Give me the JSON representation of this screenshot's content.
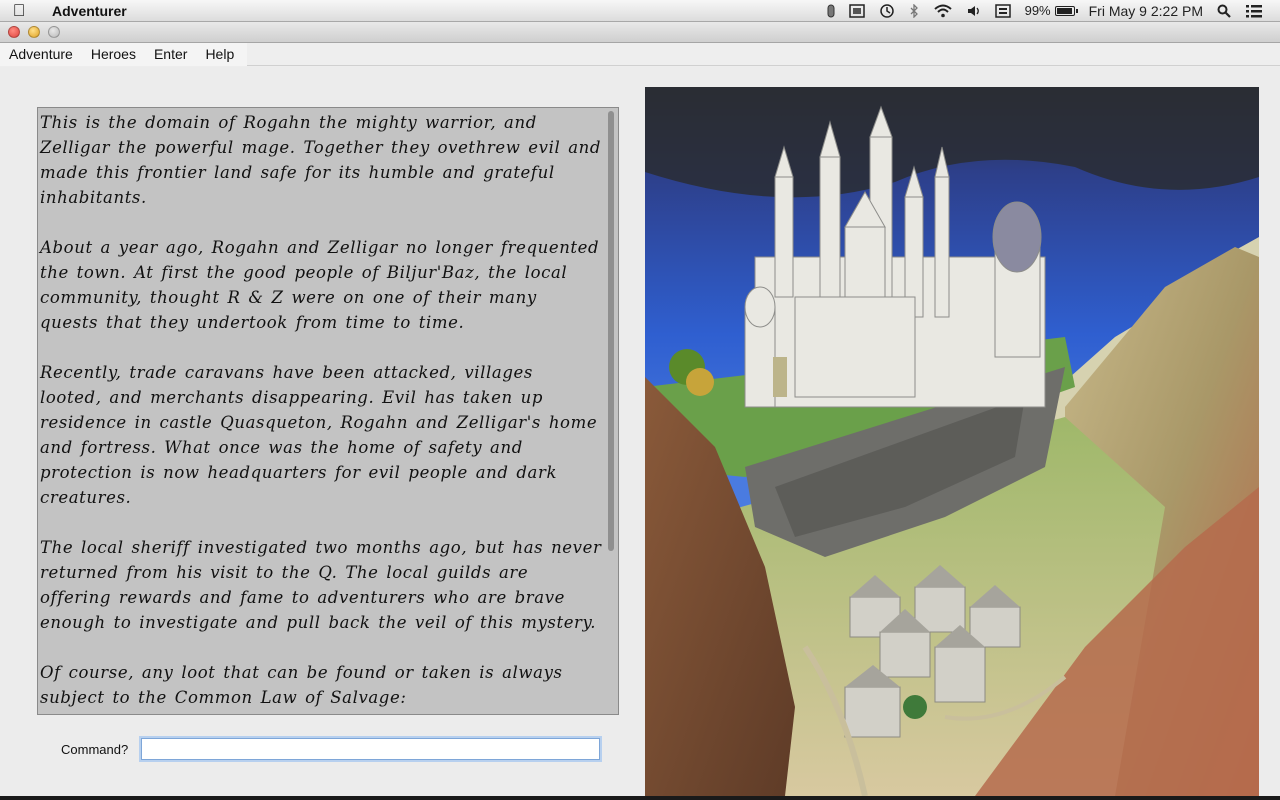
{
  "system_menubar": {
    "app_name": "Adventurer",
    "battery": "99%",
    "datetime": "Fri May 9  2:22 PM"
  },
  "window": {
    "menu": [
      "Adventure",
      "Heroes",
      "Enter",
      "Help"
    ]
  },
  "story": {
    "paragraphs": [
      "This is the domain of Rogahn the mighty warrior, and Zelligar the powerful mage. Together they ovethrew evil and made this frontier land safe for its humble and grateful inhabitants.",
      "About a year ago, Rogahn and Zelligar no longer frequented the town. At first the good people of Biljur'Baz, the local community, thought R & Z were on one of their many quests that they undertook from time to time.",
      " Recently, trade caravans have been attacked, villages looted, and merchants disappearing. Evil has taken up residence in castle Quasqueton, Rogahn and Zelligar's home and fortress. What once was the home of safety and protection is now headquarters for evil people and dark creatures.",
      "The local sheriff investigated two months ago, but has never returned from his visit to the Q. The local guilds are offering rewards and fame to adventurers who are brave enough to investigate and pull back the veil of this mystery.",
      " Of course, any loot that can be found or taken is always subject to the Common Law of Salvage:"
    ],
    "continuation": "...."
  },
  "command": {
    "label": "Command?",
    "value": ""
  },
  "colors": {
    "text_bg": "#c3c3c3",
    "window_bg": "#ececec"
  }
}
